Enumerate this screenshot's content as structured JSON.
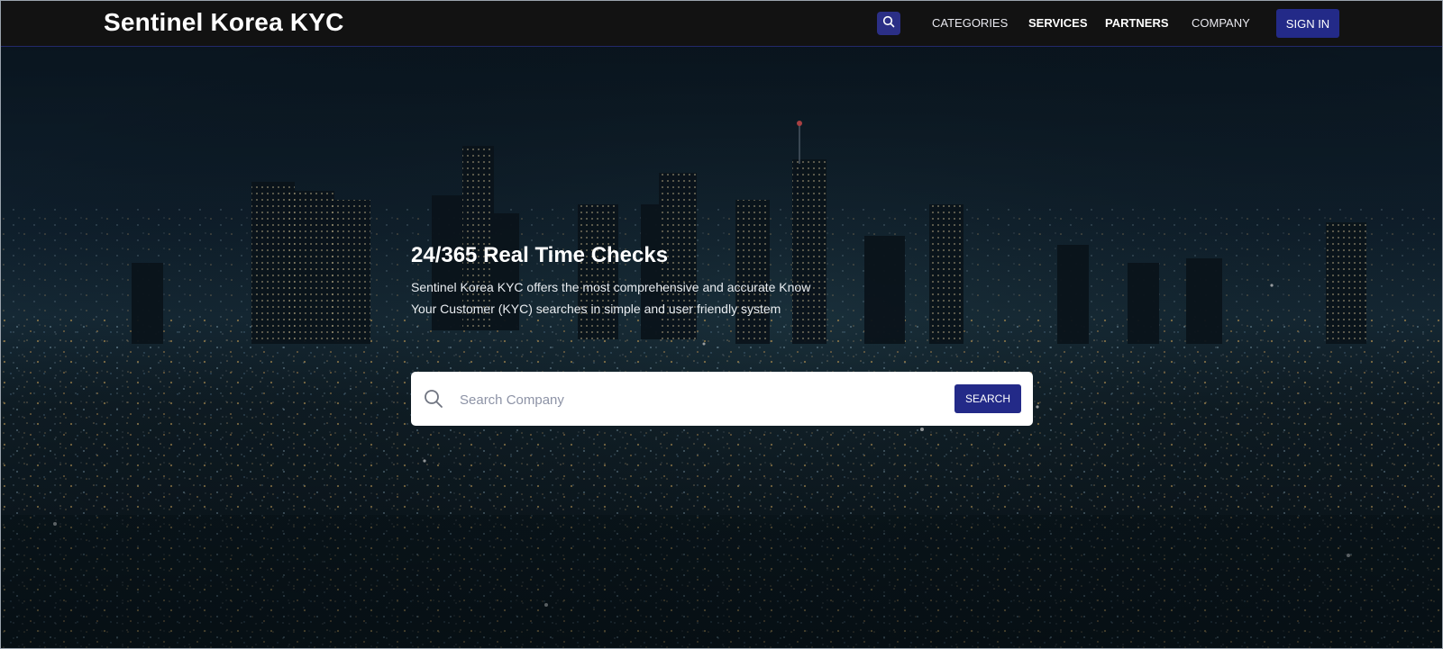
{
  "header": {
    "brand": "Sentinel Korea KYC",
    "nav": {
      "categories": "CATEGORIES",
      "services": "SERVICES",
      "partners": "PARTNERS",
      "company": "COMPANY"
    },
    "signin": "SIGN IN"
  },
  "hero": {
    "title": "24/365 Real Time Checks",
    "description": "Sentinel Korea KYC offers the most comprehensive and accurate Know Your Customer (KYC) searches in simple and user friendly system",
    "search": {
      "placeholder": "Search Company",
      "value": "",
      "button": "SEARCH"
    }
  },
  "icons": {
    "nav_search": "search-icon",
    "field_search": "search-icon"
  },
  "colors": {
    "accent": "#232a88",
    "header_bg": "#121212"
  }
}
